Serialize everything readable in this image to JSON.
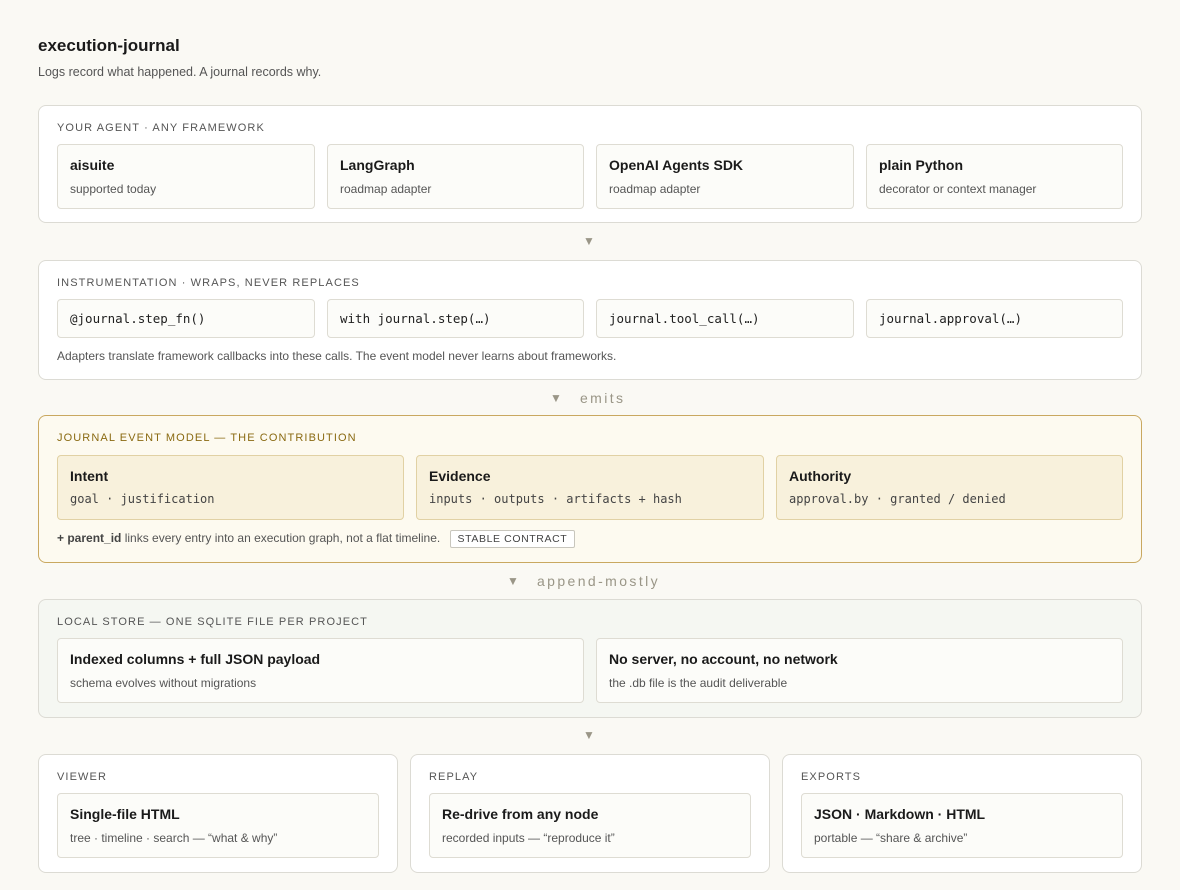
{
  "header": {
    "title": "execution-journal",
    "subtitle": "Logs record what happened. A journal records why."
  },
  "agent": {
    "label": "YOUR AGENT · ANY FRAMEWORK",
    "cards": [
      {
        "title": "aisuite",
        "sub": "supported today"
      },
      {
        "title": "LangGraph",
        "sub": "roadmap adapter"
      },
      {
        "title": "OpenAI Agents SDK",
        "sub": "roadmap adapter"
      },
      {
        "title": "plain Python",
        "sub": "decorator or context manager"
      }
    ]
  },
  "instrumentation": {
    "label": "INSTRUMENTATION · WRAPS, NEVER REPLACES",
    "calls": [
      "@journal.step_fn()",
      "with journal.step(…)",
      "journal.tool_call(…)",
      "journal.approval(…)"
    ],
    "note": "Adapters translate framework callbacks into these calls. The event model never learns about frameworks."
  },
  "arrows": {
    "a1": "▼",
    "a2": "▼",
    "a2_text": "emits",
    "a3": "▼",
    "a3_text": "append-mostly",
    "a4": "▼"
  },
  "event_model": {
    "label": "JOURNAL EVENT MODEL — THE CONTRIBUTION",
    "cards": [
      {
        "title": "Intent",
        "fields": "goal · justification"
      },
      {
        "title": "Evidence",
        "fields": "inputs · outputs · artifacts + hash"
      },
      {
        "title": "Authority",
        "fields": "approval.by · granted / denied"
      }
    ],
    "note_bold": "+ parent_id",
    "note_text": " links every entry into an execution graph, not a flat timeline.",
    "badge": "STABLE CONTRACT"
  },
  "store": {
    "label": "LOCAL STORE — ONE SQLITE FILE PER PROJECT",
    "cards": [
      {
        "title": "Indexed columns + full JSON payload",
        "sub": "schema evolves without migrations"
      },
      {
        "title": "No server, no account, no network",
        "sub": "the .db file is the audit deliverable"
      }
    ]
  },
  "outputs": [
    {
      "label": "VIEWER",
      "title": "Single-file HTML",
      "sub": "tree · timeline · search — “what & why”"
    },
    {
      "label": "REPLAY",
      "title": "Re-drive from any node",
      "sub": "recorded inputs — “reproduce it”"
    },
    {
      "label": "EXPORTS",
      "title": "JSON · Markdown · HTML",
      "sub": "portable — “share & archive”"
    }
  ]
}
